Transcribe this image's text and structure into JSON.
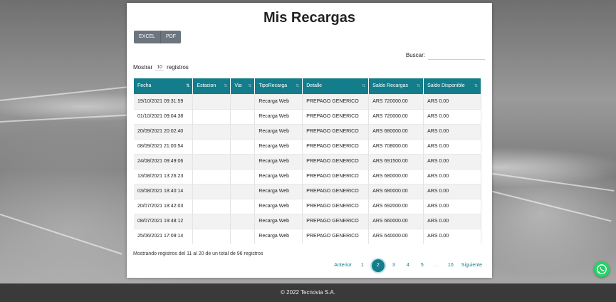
{
  "page": {
    "title": "Mis Recargas"
  },
  "export_buttons": {
    "excel": "EXCEL",
    "pdf": "PDF"
  },
  "search": {
    "label": "Buscar:",
    "value": ""
  },
  "length": {
    "prefix": "Mostrar",
    "value": "10",
    "suffix": "registros"
  },
  "table": {
    "headers": [
      "Fecha",
      "Estacion",
      "Via",
      "TipoRecarga",
      "Detalle",
      "Saldo Recargas",
      "Saldo Disponible"
    ],
    "rows": [
      [
        "19/10/2021 09:31:59",
        "",
        "",
        "Recarga Web",
        "PREPAGO GENERICO",
        "ARS 720000.00",
        "ARS 0.00"
      ],
      [
        "01/10/2021 09:04:38",
        "",
        "",
        "Recarga Web",
        "PREPAGO GENERICO",
        "ARS 720000.00",
        "ARS 0.00"
      ],
      [
        "20/09/2021 20:02:40",
        "",
        "",
        "Recarga Web",
        "PREPAGO GENERICO",
        "ARS 680000.00",
        "ARS 0.00"
      ],
      [
        "08/09/2021 21:00:54",
        "",
        "",
        "Recarga Web",
        "PREPAGO GENERICO",
        "ARS 708000.00",
        "ARS 0.00"
      ],
      [
        "24/08/2021 09:49:06",
        "",
        "",
        "Recarga Web",
        "PREPAGO GENERICO",
        "ARS 691500.00",
        "ARS 0.00"
      ],
      [
        "13/08/2021 13:26:23",
        "",
        "",
        "Recarga Web",
        "PREPAGO GENERICO",
        "ARS 680000.00",
        "ARS 0.00"
      ],
      [
        "03/08/2021 18:40:14",
        "",
        "",
        "Recarga Web",
        "PREPAGO GENERICO",
        "ARS 680000.00",
        "ARS 0.00"
      ],
      [
        "20/07/2021 18:42:03",
        "",
        "",
        "Recarga Web",
        "PREPAGO GENERICO",
        "ARS 692000.00",
        "ARS 0.00"
      ],
      [
        "08/07/2021 19:48:12",
        "",
        "",
        "Recarga Web",
        "PREPAGO GENERICO",
        "ARS 660000.00",
        "ARS 0.00"
      ],
      [
        "25/06/2021 17:09:14",
        "",
        "",
        "Recarga Web",
        "PREPAGO GENERICO",
        "ARS 640000.00",
        "ARS 0.00"
      ]
    ]
  },
  "info": "Mostrando registros del 11 al 20 de un total de 96 registros",
  "pagination": {
    "prev": "Anterior",
    "pages": [
      "1",
      "2",
      "3",
      "4",
      "5",
      "…",
      "10"
    ],
    "active": "2",
    "next": "Siguiente"
  },
  "footer": {
    "text": "© 2022 Tecnovia S.A."
  },
  "colors": {
    "accent": "#137d8c",
    "button": "#6c757d",
    "footer": "#3a3a3a",
    "whatsapp": "#25d366"
  },
  "icons": {
    "sort": "sort-arrows-icon",
    "whatsapp": "whatsapp-icon"
  }
}
